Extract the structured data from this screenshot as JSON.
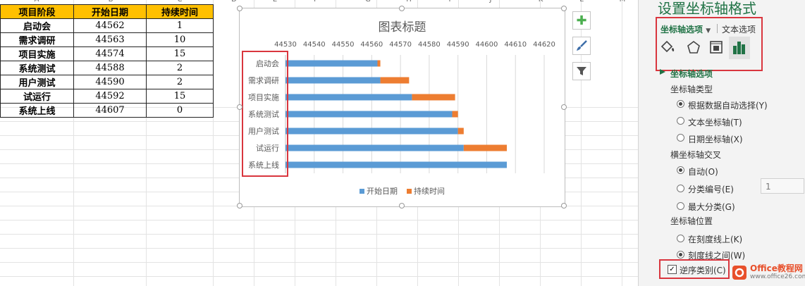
{
  "sheet": {
    "col_letters": [
      "A",
      "B",
      "C",
      "D",
      "E",
      "F",
      "G",
      "H",
      "I",
      "J",
      "K",
      "L",
      "M"
    ],
    "headers": [
      "项目阶段",
      "开始日期",
      "持续时间"
    ],
    "rows": [
      {
        "name": "启动会",
        "start": "44562",
        "duration": "1"
      },
      {
        "name": "需求调研",
        "start": "44563",
        "duration": "10"
      },
      {
        "name": "项目实施",
        "start": "44574",
        "duration": "15"
      },
      {
        "name": "系统测试",
        "start": "44588",
        "duration": "2"
      },
      {
        "name": "用户测试",
        "start": "44590",
        "duration": "2"
      },
      {
        "name": "试运行",
        "start": "44592",
        "duration": "15"
      },
      {
        "name": "系统上线",
        "start": "44607",
        "duration": "0"
      }
    ]
  },
  "chart_data": {
    "type": "bar",
    "title": "图表标题",
    "categories": [
      "启动会",
      "需求调研",
      "项目实施",
      "系统测试",
      "用户测试",
      "试运行",
      "系统上线"
    ],
    "series": [
      {
        "name": "开始日期",
        "values": [
          44562,
          44563,
          44574,
          44588,
          44590,
          44592,
          44607
        ],
        "color": "#5b9bd5"
      },
      {
        "name": "持续时间",
        "values": [
          1,
          10,
          15,
          2,
          2,
          15,
          0
        ],
        "color": "#ed7d31"
      }
    ],
    "stacked": true,
    "orientation": "horizontal",
    "xlim": [
      44530,
      44620
    ],
    "x_ticks": [
      "44530",
      "44540",
      "44550",
      "44560",
      "44570",
      "44580",
      "44590",
      "44600",
      "44610",
      "44620"
    ],
    "axis_position": "top",
    "grid": true,
    "legend": "bottom"
  },
  "chart_buttons": [
    {
      "name": "add-element",
      "icon": "plus-icon",
      "glyph": "✚"
    },
    {
      "name": "chart-style",
      "icon": "brush-icon",
      "glyph": "🖌"
    },
    {
      "name": "chart-filter",
      "icon": "filter-icon",
      "glyph": "⏷"
    }
  ],
  "pane": {
    "title": "设置坐标轴格式",
    "tab_axis": "坐标轴选项",
    "tab_text": "文本选项",
    "section": "坐标轴选项",
    "axis_type_label": "坐标轴类型",
    "axis_type_options": [
      "根据数据自动选择(Y)",
      "文本坐标轴(T)",
      "日期坐标轴(X)"
    ],
    "cross_label": "横坐标轴交叉",
    "cross_options": [
      "自动(O)",
      "分类编号(E)",
      "最大分类(G)"
    ],
    "cross_value": "1",
    "position_label": "坐标轴位置",
    "position_options": [
      "在刻度线上(K)",
      "刻度线之间(W)"
    ],
    "reverse_label": "逆序类别(C)",
    "reverse_checked": true
  },
  "watermark": {
    "brand": "Office教程网",
    "url": "www.office26.com",
    "accent": "#e8502b"
  },
  "colors": {
    "accent_green": "#217346",
    "highlight_red": "#d9363e",
    "header_yellow": "#ffc000"
  }
}
